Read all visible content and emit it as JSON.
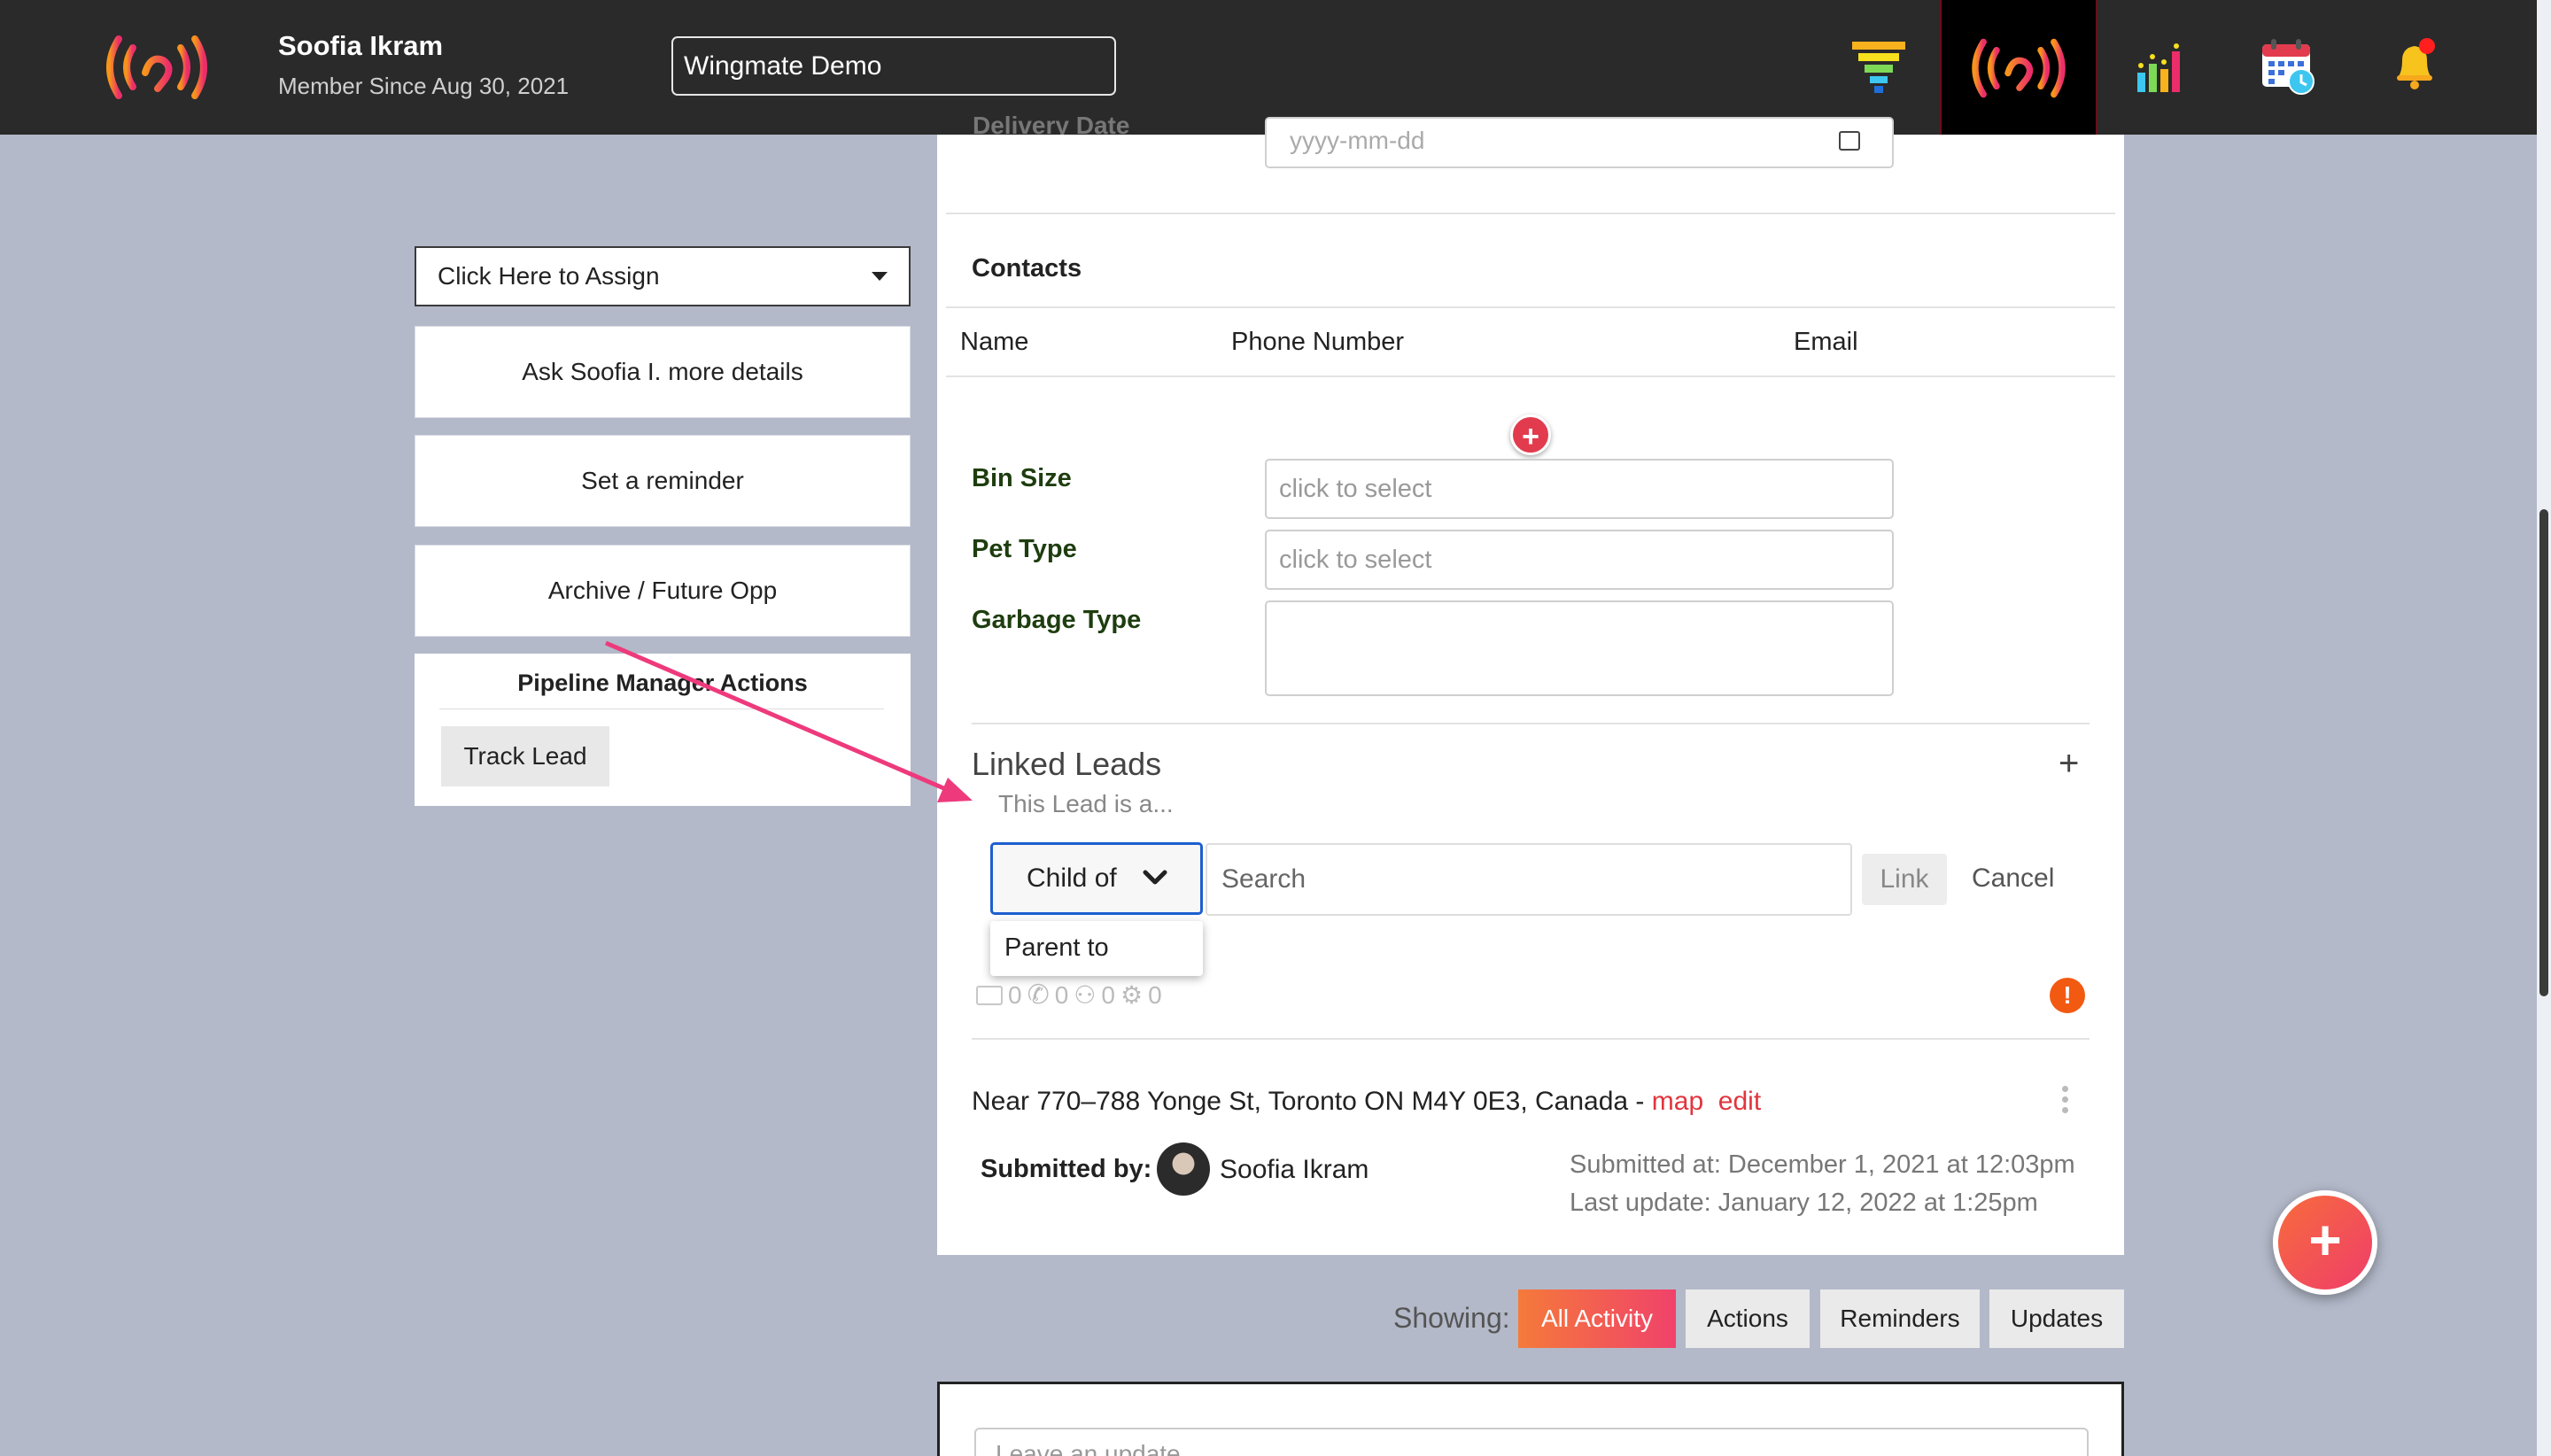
{
  "header": {
    "user_name": "Soofia Ikram",
    "member_since": "Member Since Aug 30, 2021",
    "company": "Wingmate Demo",
    "nav_icons": [
      "funnel-icon",
      "wingmate-signal-icon",
      "bar-chart-icon",
      "calendar-icon",
      "bell-icon"
    ],
    "notification_dot_color": "#ff1f1f"
  },
  "sidebar": {
    "assign_placeholder": "Click Here to Assign",
    "buttons": [
      "Ask Soofia I. more details",
      "Set a reminder",
      "Archive / Future Opp"
    ],
    "pipeline_title": "Pipeline Manager Actions",
    "track_lead": "Track Lead"
  },
  "lead": {
    "delivery_date_label": "Delivery Date",
    "delivery_date_placeholder": "yyyy-mm-dd",
    "contacts": {
      "title": "Contacts",
      "columns": [
        "Name",
        "Phone Number",
        "Email"
      ]
    },
    "fields": [
      {
        "label": "Bin Size",
        "value": "click to select"
      },
      {
        "label": "Pet Type",
        "value": "click to select"
      },
      {
        "label": "Garbage Type",
        "value": ""
      }
    ],
    "linked_leads": {
      "title": "Linked Leads",
      "add": "+",
      "subtitle": "This Lead is a...",
      "relation_selected": "Child of",
      "relation_options": [
        "Parent to"
      ],
      "search_placeholder": "Search",
      "link_label": "Link",
      "cancel_label": "Cancel"
    },
    "stats": [
      "0",
      "0",
      "0",
      "0"
    ],
    "address": "Near 770–788 Yonge St, Toronto ON M4Y 0E3, Canada - ",
    "map_link": "map",
    "edit_link": "edit",
    "submitted_by_label": "Submitted by:",
    "submitted_by_name": "Soofia Ikram",
    "submitted_at": "Submitted at: December 1, 2021 at 12:03pm",
    "last_update": "Last update: January 12, 2022 at 1:25pm"
  },
  "activity": {
    "showing_label": "Showing:",
    "tabs": [
      "All Activity",
      "Actions",
      "Reminders",
      "Updates"
    ],
    "update_placeholder": "Leave an update..."
  },
  "colors": {
    "accent_red": "#e23b4e",
    "link_red": "#e2353e",
    "active_tab_gradient": [
      "#f57a3a",
      "#f0426a"
    ],
    "annotation_arrow": "#ee3a7c"
  }
}
